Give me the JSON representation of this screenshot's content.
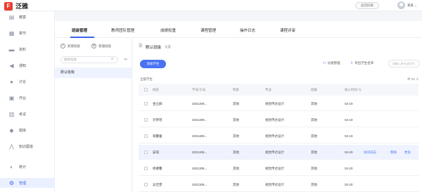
{
  "app": {
    "title": "泛雅",
    "back_label": "返回旧版",
    "username": "某某"
  },
  "nav": [
    {
      "id": "course",
      "label": "教案",
      "icon": "doc-icon",
      "glyph": "▤",
      "active": false
    },
    {
      "id": "chapter",
      "label": "章节",
      "icon": "book-icon",
      "glyph": "▦",
      "active": false
    },
    {
      "id": "material",
      "label": "资料",
      "icon": "folder-icon",
      "glyph": "▬",
      "active": false
    },
    {
      "id": "notice",
      "label": "通知",
      "icon": "megaphone-icon",
      "glyph": "◀",
      "active": false
    },
    {
      "id": "discuss",
      "label": "讨论",
      "icon": "chat-icon",
      "glyph": "●",
      "active": false
    },
    {
      "id": "homework",
      "label": "作业",
      "icon": "homework-icon",
      "glyph": "▣",
      "active": false
    },
    {
      "id": "exam",
      "label": "考试",
      "icon": "exam-icon",
      "glyph": "▥",
      "active": false
    },
    {
      "id": "bank",
      "label": "题库",
      "icon": "stack-icon",
      "glyph": "◆",
      "active": false
    },
    {
      "id": "graph",
      "label": "知识图谱",
      "icon": "graph-icon",
      "glyph": "⋀",
      "active": false
    },
    {
      "id": "stats",
      "label": "统计",
      "icon": "pie-icon",
      "glyph": "◐",
      "active": false
    },
    {
      "id": "manage",
      "label": "管理",
      "icon": "gear-icon",
      "glyph": "⚙",
      "active": true
    }
  ],
  "tabs": [
    "班级管理",
    "教师团队管理",
    "成绩权重",
    "课程管理",
    "操作日志",
    "课程评审"
  ],
  "class_panel": {
    "new_label": "新建班级",
    "manage_label": "管理班级",
    "search_placeholder": "搜索班级",
    "items": [
      "默认班级"
    ]
  },
  "content": {
    "class_title": "默认班级",
    "settings_label": "设置",
    "add_student_label": "添加学生",
    "group_label": "分组管理",
    "export_label": "导出学生名单",
    "search_placeholder": "请输入姓名或学号",
    "all_students_label": "全部学生",
    "total_label": "共 30 人"
  },
  "table": {
    "headers": [
      "姓名",
      "学号/工号",
      "院系",
      "专业",
      "班级",
      "加入时间 ⇅"
    ],
    "rows": [
      {
        "name": "金立群",
        "id": "2031309...",
        "dept": "其他",
        "major": "视觉传达设计",
        "class": "其他",
        "date": "02-19",
        "hl": false
      },
      {
        "name": "许梦瑶",
        "id": "2031309...",
        "dept": "其他",
        "major": "视觉传达设计",
        "class": "其他",
        "date": "02-19",
        "hl": false
      },
      {
        "name": "蒋馨蕾",
        "id": "2031309...",
        "dept": "其他",
        "major": "视觉传达设计",
        "class": "其他",
        "date": "02-19",
        "hl": false
      },
      {
        "name": "安琪",
        "id": "2031309...",
        "dept": "其他",
        "major": "视觉传达设计",
        "class": "其他",
        "date": "02-20",
        "hl": true
      },
      {
        "name": "杨婆馨",
        "id": "2031309...",
        "dept": "其他",
        "major": "视觉传达设计",
        "class": "其他",
        "date": "02-20",
        "hl": false
      },
      {
        "name": "吴佳雯",
        "id": "2031309...",
        "dept": "其他",
        "major": "视觉传达设计",
        "class": "其他",
        "date": "02-20",
        "hl": false
      }
    ],
    "row_ops": [
      "访问日志",
      "移除",
      "更多"
    ]
  },
  "colors": {
    "accent": "#4a72f2",
    "brand": "#e8402f",
    "highlight": "#eef3ff"
  }
}
